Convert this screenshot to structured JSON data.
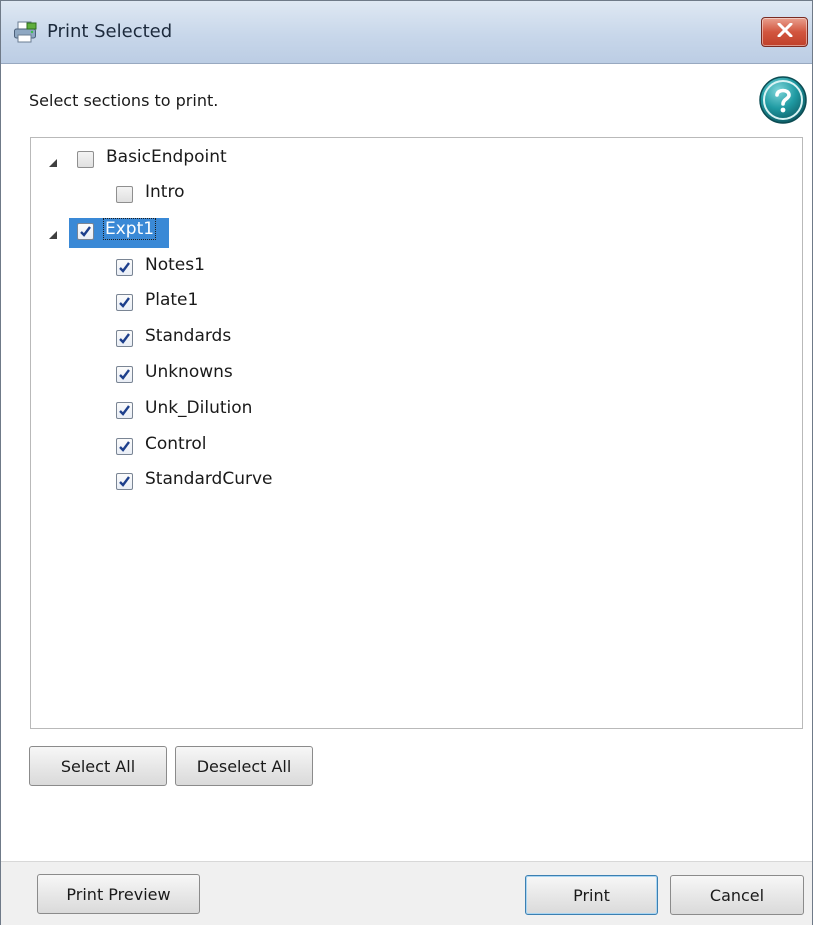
{
  "window": {
    "title": "Print Selected"
  },
  "instruction": "Select sections to print.",
  "tree": [
    {
      "label": "BasicEndpoint",
      "checked": false,
      "expanded": true,
      "level": 0
    },
    {
      "label": "Intro",
      "checked": false,
      "level": 1
    },
    {
      "label": "Expt1",
      "checked": true,
      "expanded": true,
      "level": 0,
      "selected": true
    },
    {
      "label": "Notes1",
      "checked": true,
      "level": 1
    },
    {
      "label": "Plate1",
      "checked": true,
      "level": 1
    },
    {
      "label": "Standards",
      "checked": true,
      "level": 1
    },
    {
      "label": "Unknowns",
      "checked": true,
      "level": 1
    },
    {
      "label": "Unk_Dilution",
      "checked": true,
      "level": 1
    },
    {
      "label": "Control",
      "checked": true,
      "level": 1
    },
    {
      "label": "StandardCurve",
      "checked": true,
      "level": 1
    }
  ],
  "buttons": {
    "select_all": "Select All",
    "deselect_all": "Deselect All",
    "print_preview": "Print Preview",
    "print": "Print",
    "cancel": "Cancel"
  },
  "icons": {
    "app": "printer-icon",
    "close": "close-icon",
    "help": "help-icon",
    "expander": "expanded-triangle-icon",
    "check": "checkmark-icon"
  },
  "colors": {
    "selection": "#3a89d6",
    "close_button": "#c8452f",
    "help_button": "#1f8b93",
    "check_mark": "#1d3f8c"
  }
}
